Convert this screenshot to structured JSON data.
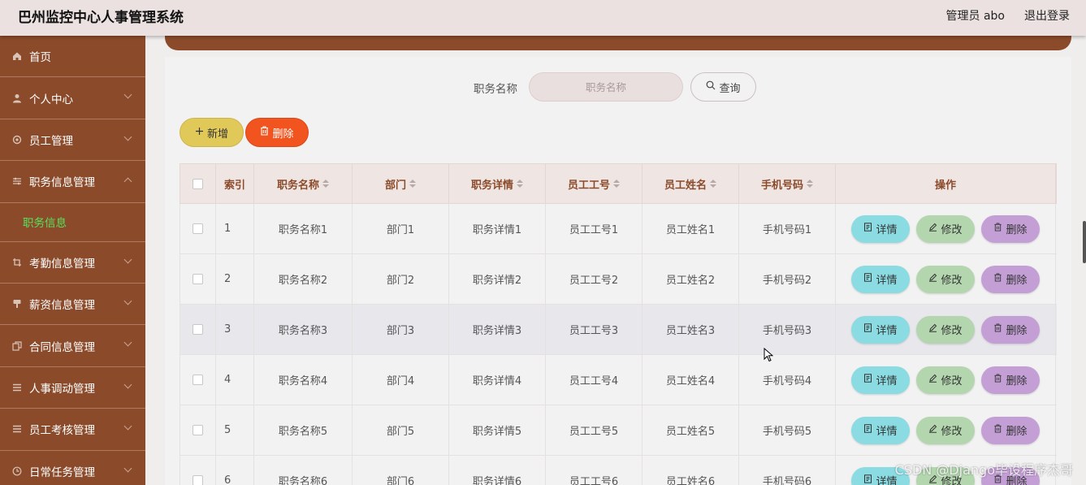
{
  "header": {
    "title": "巴州监控中心人事管理系统",
    "admin": "管理员 abo",
    "logout": "退出登录"
  },
  "sidebar": {
    "items": [
      {
        "label": "首页",
        "icon": "home-icon"
      },
      {
        "label": "个人中心",
        "icon": "user-icon"
      },
      {
        "label": "员工管理",
        "icon": "settings-icon"
      },
      {
        "label": "职务信息管理",
        "icon": "sliders-icon",
        "expanded": true
      },
      {
        "label": "考勤信息管理",
        "icon": "crop-icon"
      },
      {
        "label": "薪资信息管理",
        "icon": "stamp-icon"
      },
      {
        "label": "合同信息管理",
        "icon": "copy-icon"
      },
      {
        "label": "人事调动管理",
        "icon": "menu-icon"
      },
      {
        "label": "员工考核管理",
        "icon": "menu-icon"
      },
      {
        "label": "日常任务管理",
        "icon": "clock-icon"
      }
    ],
    "sub_item": {
      "label": "职务信息"
    },
    "active_color": "#58e15a"
  },
  "search": {
    "label": "职务名称",
    "placeholder": "职务名称",
    "button": "查询"
  },
  "actions": {
    "add": "新增",
    "delete": "删除"
  },
  "table": {
    "headers": {
      "index": "索引",
      "name": "职务名称",
      "dept": "部门",
      "detail": "职务详情",
      "empno": "员工工号",
      "empname": "员工姓名",
      "phone": "手机号码",
      "ops": "操作"
    },
    "rows": [
      {
        "index": "1",
        "name": "职务名称1",
        "dept": "部门1",
        "detail": "职务详情1",
        "empno": "员工工号1",
        "empname": "员工姓名1",
        "phone": "手机号码1"
      },
      {
        "index": "2",
        "name": "职务名称2",
        "dept": "部门2",
        "detail": "职务详情2",
        "empno": "员工工号2",
        "empname": "员工姓名2",
        "phone": "手机号码2"
      },
      {
        "index": "3",
        "name": "职务名称3",
        "dept": "部门3",
        "detail": "职务详情3",
        "empno": "员工工号3",
        "empname": "员工姓名3",
        "phone": "手机号码3"
      },
      {
        "index": "4",
        "name": "职务名称4",
        "dept": "部门4",
        "detail": "职务详情4",
        "empno": "员工工号4",
        "empname": "员工姓名4",
        "phone": "手机号码4"
      },
      {
        "index": "5",
        "name": "职务名称5",
        "dept": "部门5",
        "detail": "职务详情5",
        "empno": "员工工号5",
        "empname": "员工姓名5",
        "phone": "手机号码5"
      },
      {
        "index": "6",
        "name": "职务名称6",
        "dept": "部门6",
        "detail": "职务详情6",
        "empno": "员工工号6",
        "empname": "员工姓名6",
        "phone": "手机号码6"
      }
    ],
    "row_actions": {
      "detail": "详情",
      "edit": "修改",
      "delete": "删除"
    }
  },
  "watermark": "CSDN @Django毕设程序杰哥",
  "colors": {
    "sidebar": "#8b4b2b",
    "add": "#e1c959",
    "delete": "#f2541f",
    "detail": "#8adbe2",
    "edit": "#b3d6ae",
    "remove": "#c49fd6"
  }
}
